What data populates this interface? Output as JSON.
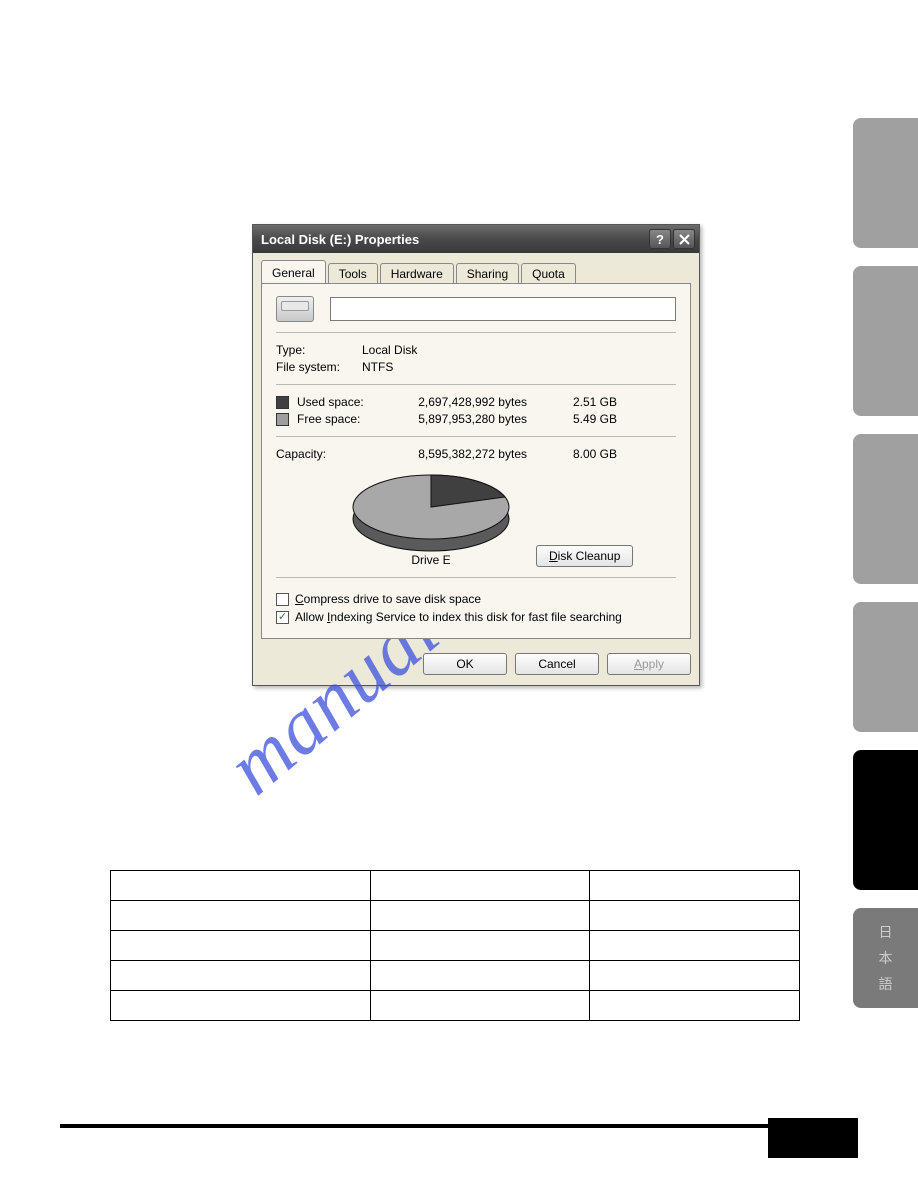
{
  "watermark_text": "manualshive.com",
  "dialog": {
    "title": "Local Disk (E:) Properties",
    "tabs": [
      "General",
      "Tools",
      "Hardware",
      "Sharing",
      "Quota"
    ],
    "type_label": "Type:",
    "type_value": "Local Disk",
    "fs_label": "File system:",
    "fs_value": "NTFS",
    "used_label": "Used space:",
    "used_bytes": "2,697,428,992 bytes",
    "used_gb": "2.51 GB",
    "free_label": "Free space:",
    "free_bytes": "5,897,953,280 bytes",
    "free_gb": "5.49 GB",
    "capacity_label": "Capacity:",
    "capacity_bytes": "8,595,382,272 bytes",
    "capacity_gb": "8.00 GB",
    "drive_caption": "Drive E",
    "disk_cleanup_btn": "Disk Cleanup",
    "compress_text": "Compress drive to save disk space",
    "indexing_text": "Allow Indexing Service to index this disk for fast file searching",
    "ok_btn": "OK",
    "cancel_btn": "Cancel",
    "apply_btn": "Apply"
  },
  "chart_data": {
    "type": "pie",
    "title": "Drive E",
    "series": [
      {
        "name": "Used space",
        "value": 2697428992,
        "display": "2.51 GB",
        "color": "#404040"
      },
      {
        "name": "Free space",
        "value": 5897953280,
        "display": "5.49 GB",
        "color": "#9e9e9e"
      }
    ],
    "total": {
      "name": "Capacity",
      "value": 8595382272,
      "display": "8.00 GB"
    }
  },
  "side_tab_chars": [
    "日",
    "本",
    "語"
  ]
}
